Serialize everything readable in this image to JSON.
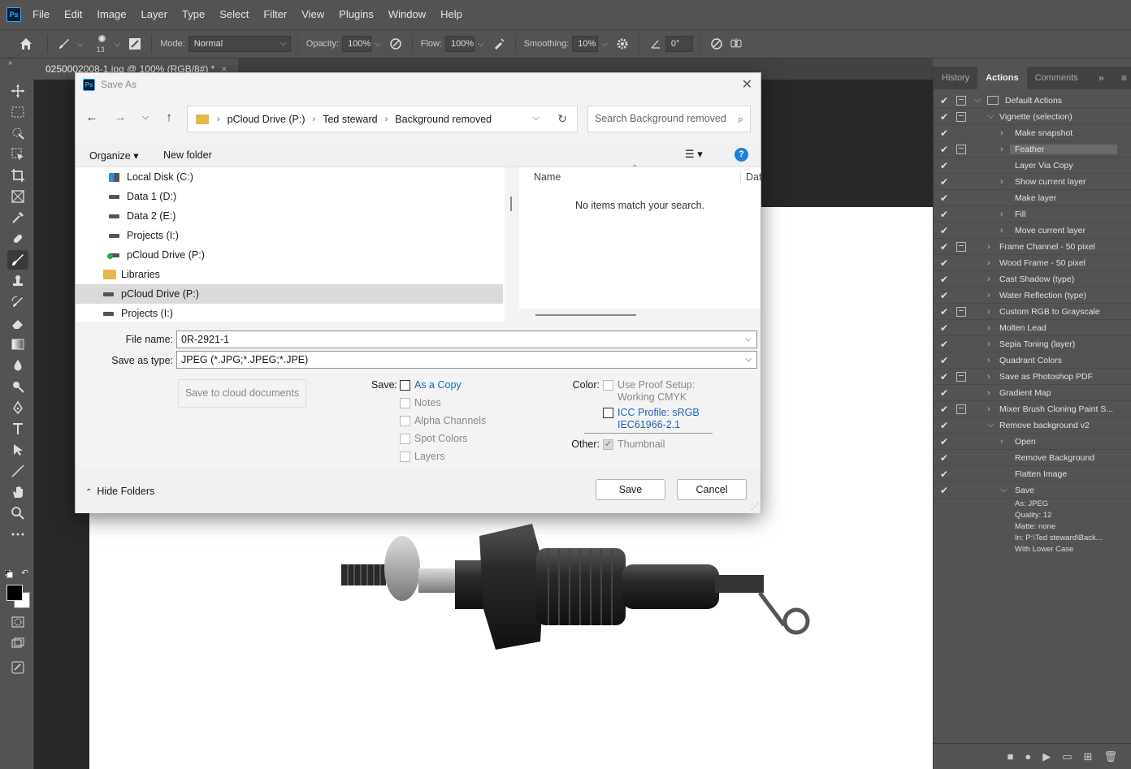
{
  "app": {
    "logo": "Ps",
    "menu": [
      "File",
      "Edit",
      "Image",
      "Layer",
      "Type",
      "Select",
      "Filter",
      "View",
      "Plugins",
      "Window",
      "Help"
    ]
  },
  "options": {
    "brush_size": "13",
    "mode_label": "Mode:",
    "mode_value": "Normal",
    "opacity_label": "Opacity:",
    "opacity_value": "100%",
    "flow_label": "Flow:",
    "flow_value": "100%",
    "smoothing_label": "Smoothing:",
    "smoothing_value": "10%",
    "angle_value": "0°"
  },
  "document": {
    "tab_title": "0250002008-1.jpg @ 100% (RGB/8#) *",
    "tab_close": "×"
  },
  "panel": {
    "tabs": [
      "History",
      "Actions",
      "Comments"
    ],
    "active_tab": "Actions",
    "actions": [
      {
        "label": "Default Actions",
        "dialog": true,
        "level": 0,
        "expanded": true,
        "folder": true
      },
      {
        "label": "Vignette (selection)",
        "dialog": true,
        "level": 1,
        "expanded": true
      },
      {
        "label": "Make snapshot",
        "dialog": false,
        "level": 2,
        "expandable": true
      },
      {
        "label": "Feather",
        "dialog": true,
        "level": 2,
        "expandable": true,
        "selected": true
      },
      {
        "label": "Layer Via Copy",
        "dialog": false,
        "level": 2
      },
      {
        "label": "Show current layer",
        "dialog": false,
        "level": 2,
        "expandable": true
      },
      {
        "label": "Make layer",
        "dialog": false,
        "level": 2
      },
      {
        "label": "Fill",
        "dialog": false,
        "level": 2,
        "expandable": true
      },
      {
        "label": "Move current layer",
        "dialog": false,
        "level": 2,
        "expandable": true
      },
      {
        "label": "Frame Channel - 50 pixel",
        "dialog": true,
        "level": 1
      },
      {
        "label": "Wood Frame - 50 pixel",
        "dialog": false,
        "level": 1
      },
      {
        "label": "Cast Shadow (type)",
        "dialog": false,
        "level": 1
      },
      {
        "label": "Water Reflection (type)",
        "dialog": false,
        "level": 1
      },
      {
        "label": "Custom RGB to Grayscale",
        "dialog": true,
        "level": 1
      },
      {
        "label": "Molten Lead",
        "dialog": false,
        "level": 1
      },
      {
        "label": "Sepia Toning (layer)",
        "dialog": false,
        "level": 1
      },
      {
        "label": "Quadrant Colors",
        "dialog": false,
        "level": 1
      },
      {
        "label": "Save as Photoshop PDF",
        "dialog": true,
        "level": 1
      },
      {
        "label": "Gradient Map",
        "dialog": false,
        "level": 1
      },
      {
        "label": "Mixer Brush Cloning Paint S...",
        "dialog": true,
        "level": 1
      },
      {
        "label": "Remove background v2",
        "dialog": false,
        "level": 1,
        "expanded": true
      },
      {
        "label": "Open",
        "dialog": false,
        "level": 2,
        "expandable": true
      },
      {
        "label": "Remove Background",
        "dialog": false,
        "level": 2
      },
      {
        "label": "Flatten Image",
        "dialog": false,
        "level": 2
      },
      {
        "label": "Save",
        "dialog": false,
        "level": 2,
        "expanded": true
      }
    ],
    "save_details": [
      "As: JPEG",
      "Quality: 12",
      "Matte: none",
      "In: P:\\Ted steward\\Back...",
      "With Lower Case"
    ]
  },
  "dialog": {
    "title": "Save As",
    "close": "✕",
    "breadcrumb": [
      "pCloud Drive (P:)",
      "Ted steward",
      "Background removed"
    ],
    "search_placeholder": "Search Background removed",
    "organize": "Organize ▾",
    "new_folder": "New folder",
    "help": "?",
    "tree": [
      {
        "label": "Local Disk (C:)",
        "icon": "drive-c",
        "indent": 1
      },
      {
        "label": "Data 1 (D:)",
        "icon": "drive",
        "indent": 1
      },
      {
        "label": "Data 2 (E:)",
        "icon": "drive",
        "indent": 1
      },
      {
        "label": "Projects (I:)",
        "icon": "drive",
        "indent": 1
      },
      {
        "label": "pCloud Drive (P:)",
        "icon": "drive-cloud",
        "indent": 1
      },
      {
        "label": "Libraries",
        "icon": "folder",
        "indent": 0
      },
      {
        "label": "pCloud Drive (P:)",
        "icon": "drive",
        "indent": 0,
        "selected": true
      },
      {
        "label": "Projects (I:)",
        "icon": "drive",
        "indent": 0
      }
    ],
    "col_name": "Name",
    "col_date": "Dat",
    "empty_text": "No items match your search.",
    "file_name_label": "File name:",
    "file_name_value": "0R-2921-1",
    "save_type_label": "Save as type:",
    "save_type_value": "JPEG (*.JPG;*.JPEG;*.JPE)",
    "cloud_button": "Save to cloud documents",
    "save_label": "Save:",
    "save_options": [
      "As a Copy",
      "Notes",
      "Alpha Channels",
      "Spot Colors",
      "Layers"
    ],
    "color_label": "Color:",
    "proof_line1": "Use Proof Setup:",
    "proof_line2": "Working CMYK",
    "icc_line1": "ICC Profile:  sRGB",
    "icc_line2": "IEC61966-2.1",
    "other_label": "Other:",
    "thumbnail_label": "Thumbnail",
    "hide_folders": "Hide Folders",
    "save_button": "Save",
    "cancel_button": "Cancel"
  }
}
